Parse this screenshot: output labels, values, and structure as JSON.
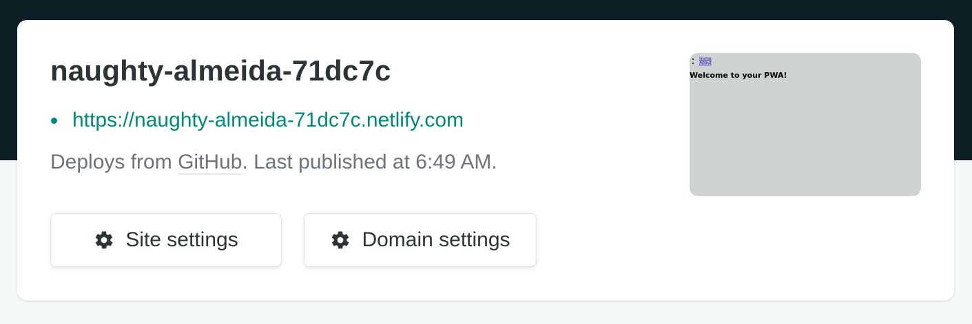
{
  "site": {
    "name": "naughty-almeida-71dc7c",
    "url": "https://naughty-almeida-71dc7c.netlify.com",
    "deploy_prefix": "Deploys from ",
    "deploy_source": "GitHub",
    "deploy_suffix": ". Last published at 6:49 AM."
  },
  "buttons": {
    "site_settings": "Site settings",
    "domain_settings": "Domain settings",
    "icon": "gear-icon"
  },
  "preview": {
    "nav": [
      "Home",
      "About"
    ],
    "heading": "Welcome to your PWA!"
  },
  "colors": {
    "header_dark": "#0e1e25",
    "link_teal": "#00897b",
    "text_dark": "#2d3436",
    "text_muted": "#6d7378",
    "preview_bg": "#cfd2d3"
  }
}
